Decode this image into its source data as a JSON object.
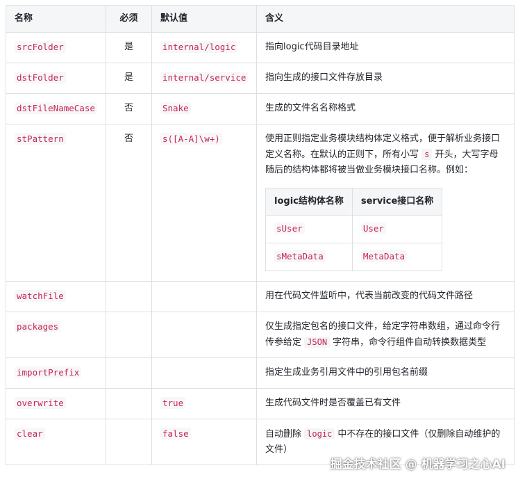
{
  "headers": [
    "名称",
    "必须",
    "默认值",
    "含义"
  ],
  "rows": [
    {
      "name": "srcFolder",
      "required": "是",
      "default": "internal/logic",
      "desc": "指向logic代码目录地址"
    },
    {
      "name": "dstFolder",
      "required": "是",
      "default": "internal/service",
      "desc": "指向生成的接口文件存放目录"
    },
    {
      "name": "dstFileNameCase",
      "required": "否",
      "default": "Snake",
      "desc": "生成的文件名名称格式"
    },
    {
      "name": "stPattern",
      "required": "否",
      "default": "s([A-A]\\w+)",
      "desc_a": "使用正则指定业务模块结构体定义格式，便于解析业务接口定义名称。在默认的正则下，所有小写 ",
      "desc_code": "s",
      "desc_b": " 开头，大写字母随后的结构体都将被当做业务模块接口名称。例如：",
      "inner": {
        "headers": [
          "logic结构体名称",
          "service接口名称"
        ],
        "rows": [
          [
            "sUser",
            "User"
          ],
          [
            "sMetaData",
            "MetaData"
          ]
        ]
      }
    },
    {
      "name": "watchFile",
      "required": "",
      "default": "",
      "desc": "用在代码文件监听中，代表当前改变的代码文件路径"
    },
    {
      "name": "packages",
      "required": "",
      "default": "",
      "desc_a": "仅生成指定包名的接口文件，给定字符串数组，通过命令行传参给定 ",
      "desc_code": "JSON",
      "desc_b": " 字符串，命令行组件自动转换数据类型"
    },
    {
      "name": "importPrefix",
      "required": "",
      "default": "",
      "desc": "指定生成业务引用文件中的引用包名前缀"
    },
    {
      "name": "overwrite",
      "required": "",
      "default": "true",
      "desc": "生成代码文件时是否覆盖已有文件"
    },
    {
      "name": "clear",
      "required": "",
      "default": "false",
      "desc_a": "自动删除 ",
      "desc_code": "logic",
      "desc_b": " 中不存在的接口文件（仅删除自动维护的文件）"
    }
  ],
  "watermark": "掘金技术社区 @ 机器学习之心AI",
  "colors": {
    "code": "#c7254e",
    "header_bg": "#f5f6f7",
    "border": "#dcdfe4"
  }
}
